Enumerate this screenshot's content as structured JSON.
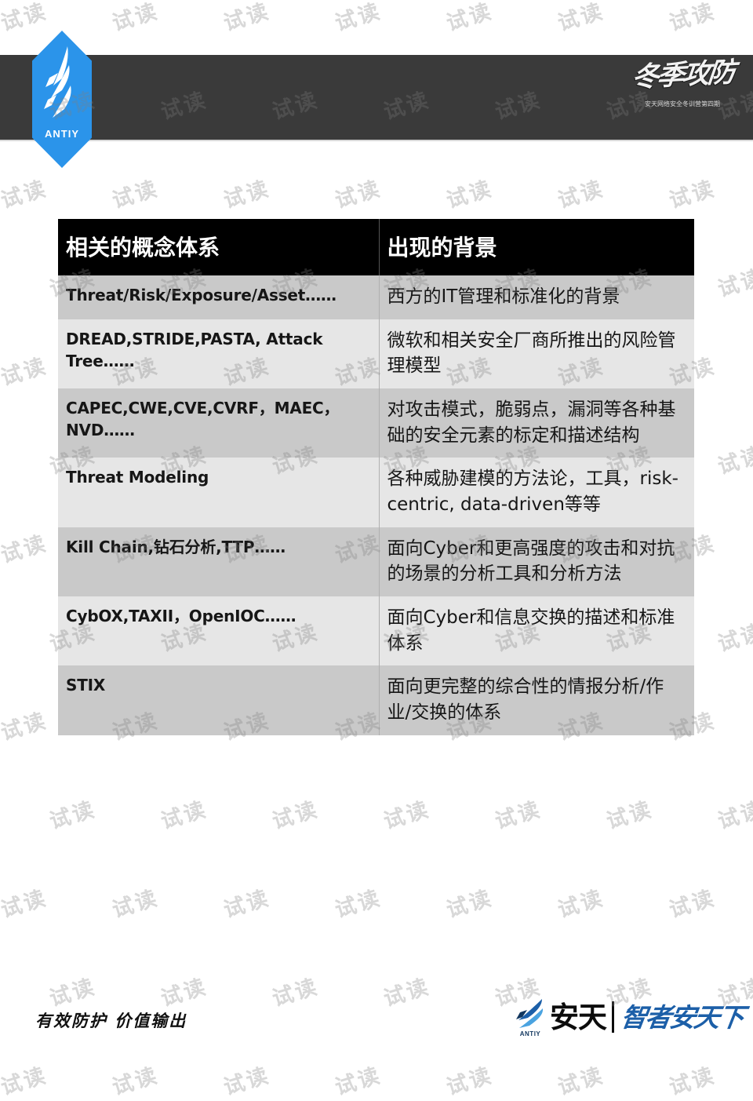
{
  "brand": {
    "logo_word": "ANTIY",
    "header_calligraphy": "冬季攻防",
    "header_calligraphy_caption": "安天网络安全冬训营第四期"
  },
  "table": {
    "headers": [
      "相关的概念体系",
      "出现的背景"
    ],
    "rows": [
      {
        "term": "Threat/Risk/Exposure/Asset……",
        "background": "西方的IT管理和标准化的背景"
      },
      {
        "term": "DREAD,STRIDE,PASTA, Attack Tree……",
        "background": "微软和相关安全厂商所推出的风险管理模型"
      },
      {
        "term": "CAPEC,CWE,CVE,CVRF，MAEC，NVD……",
        "background": "对攻击模式，脆弱点，漏洞等各种基础的安全元素的标定和描述结构"
      },
      {
        "term": "Threat Modeling",
        "background": "各种威胁建模的方法论，工具，risk-centric, data-driven等等"
      },
      {
        "term": "Kill Chain,钻石分析,TTP……",
        "background": "面向Cyber和更高强度的攻击和对抗的场景的分析工具和分析方法"
      },
      {
        "term": "CybOX,TAXII，OpenIOC……",
        "background": "面向Cyber和信息交换的描述和标准体系"
      },
      {
        "term": "STIX",
        "background": "面向更完整的综合性的情报分析/作业/交换的体系"
      }
    ]
  },
  "footer": {
    "slogan": "有效防护 价值输出",
    "logo_word": "ANTIY",
    "company": "安天",
    "tagline": "智者安天下"
  },
  "watermark": {
    "text": "试读"
  },
  "colors": {
    "header_band": "#3a3a3a",
    "accent_blue": "#2b94ea",
    "table_header_bg": "#000000",
    "row_odd": "#c9c9c9",
    "row_even": "#e6e6e6",
    "tagline_blue": "#1c5fa8"
  }
}
